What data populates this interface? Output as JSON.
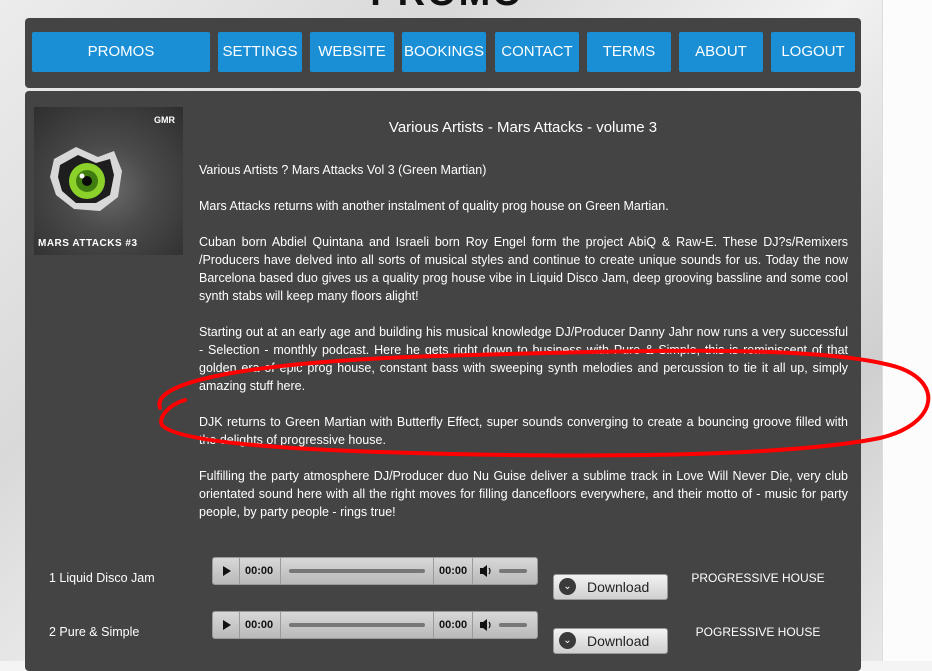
{
  "logo": {
    "text": "PROMO POOL"
  },
  "nav": {
    "items": [
      "PROMOS",
      "SETTINGS",
      "WEBSITE",
      "BOOKINGS",
      "CONTACT",
      "TERMS",
      "ABOUT",
      "LOGOUT"
    ]
  },
  "cover": {
    "tag": "GMR",
    "title": "MARS ATTACKS #3"
  },
  "album": {
    "title": "Various Artists - Mars Attacks - volume 3",
    "paragraphs": [
      "Various Artists ? Mars Attacks Vol 3 (Green Martian)",
      "Mars Attacks returns with another instalment of quality prog house on Green Martian.",
      "Cuban born Abdiel Quintana and Israeli born Roy Engel form the project AbiQ & Raw-E. These DJ?s/Remixers /Producers have delved into all sorts of musical styles and continue to create unique sounds for us. Today the now Barcelona based duo gives us a quality prog house vibe in Liquid Disco Jam, deep grooving bassline and some cool synth stabs will keep many floors alight!",
      "Starting out at an early age and building his musical knowledge DJ/Producer Danny Jahr now runs a very successful - Selection - monthly podcast. Here he gets right down to business with Pure & Simple, this is reminiscent of that golden era of epic prog house, constant bass with sweeping synth melodies and percussion to tie it all up, simply amazing stuff here.",
      "DJK returns to Green Martian with Butterfly Effect, super sounds converging to create a bouncing groove filled with the delights of progressive house.",
      "Fulfilling the party atmosphere DJ/Producer duo Nu Guise deliver a sublime track in Love Will Never Die, very club orientated sound here with all the right moves for filling dancefloors everywhere, and their motto of - music for party people, by party people - rings true!"
    ]
  },
  "tracks": [
    {
      "name": "1 Liquid Disco Jam",
      "time_current": "00:00",
      "time_total": "00:00",
      "download_label": "Download",
      "genre": "PROGRESSIVE HOUSE"
    },
    {
      "name": "2 Pure & Simple",
      "time_current": "00:00",
      "time_total": "00:00",
      "download_label": "Download",
      "genre": "POGRESSIVE HOUSE"
    }
  ],
  "colors": {
    "nav_button": "#1a8fd6",
    "panel": "#444444",
    "annotation": "#ff0000"
  }
}
